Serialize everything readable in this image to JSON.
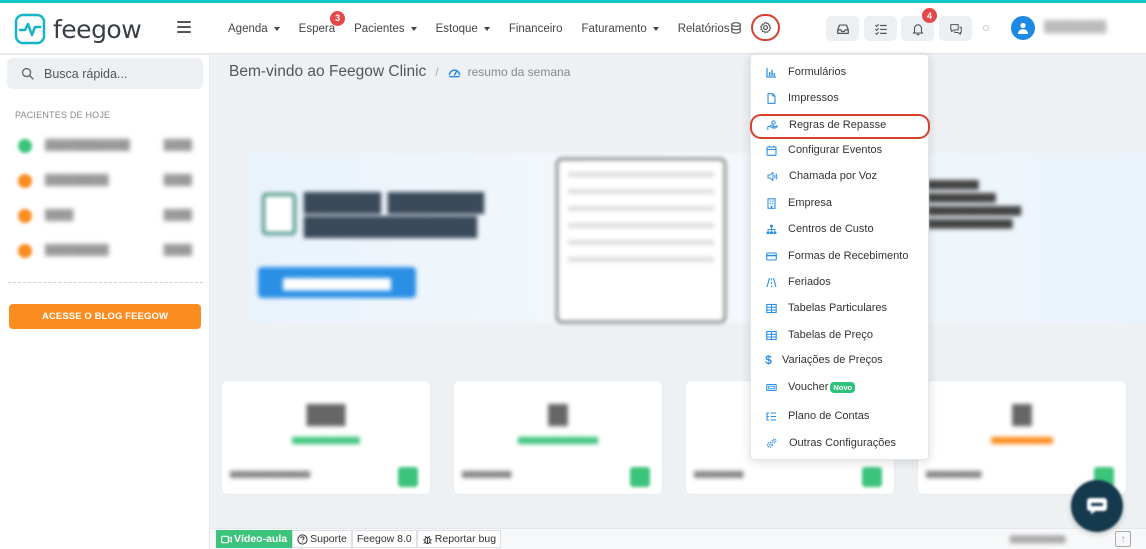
{
  "app": {
    "brand": "feegow",
    "accent_color": "#13c6c6",
    "danger_color": "#e54848"
  },
  "nav": {
    "items": [
      {
        "label": "Agenda",
        "dropdown": true
      },
      {
        "label": "Espera",
        "badge": "3"
      },
      {
        "label": "Pacientes",
        "dropdown": true
      },
      {
        "label": "Estoque",
        "dropdown": true
      },
      {
        "label": "Financeiro"
      },
      {
        "label": "Faturamento",
        "dropdown": true
      },
      {
        "label": "Relatórios"
      }
    ],
    "notifications_badge": "4"
  },
  "sidebar": {
    "search_placeholder": "Busca rápida...",
    "section_title": "PACIENTES DE HOJE",
    "blog_button": "ACESSE O BLOG FEEGOW"
  },
  "main": {
    "welcome": "Bem-vindo ao Feegow Clinic",
    "breadcrumb_sub": "resumo da semana"
  },
  "settings_menu": {
    "items": [
      {
        "label": "Formulários",
        "icon": "bar-chart-icon"
      },
      {
        "label": "Impressos",
        "icon": "document-icon"
      },
      {
        "label": "Regras de Repasse",
        "icon": "hand-money-icon",
        "highlighted": true
      },
      {
        "label": "Configurar Eventos",
        "icon": "calendar-icon"
      },
      {
        "label": "Chamada por Voz",
        "icon": "speaker-icon"
      },
      {
        "label": "Empresa",
        "icon": "building-icon"
      },
      {
        "label": "Centros de Custo",
        "icon": "sitemap-icon"
      },
      {
        "label": "Formas de Recebimento",
        "icon": "credit-card-icon"
      },
      {
        "label": "Feriados",
        "icon": "road-icon"
      },
      {
        "label": "Tabelas Particulares",
        "icon": "table-icon"
      },
      {
        "label": "Tabelas de Preço",
        "icon": "table-icon"
      },
      {
        "label": "Variações de Preços",
        "icon": "dollar-icon"
      },
      {
        "label": "Voucher",
        "icon": "ticket-icon",
        "tag": "Novo"
      },
      {
        "label": "Plano de Contas",
        "icon": "list-icon"
      },
      {
        "label": "Outras Configurações",
        "icon": "gears-icon"
      }
    ]
  },
  "footer": {
    "video": "Vídeo-aula",
    "support": "Suporte",
    "version": "Feegow 8.0",
    "bug": "Reportar bug"
  }
}
